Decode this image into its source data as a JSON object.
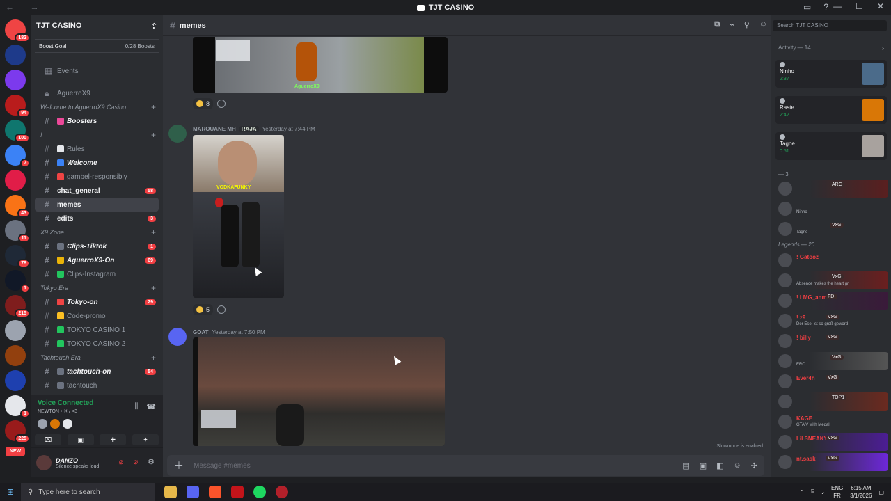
{
  "window": {
    "title": "TJT CASINO",
    "nav_arrows": "← →",
    "controls": [
      "—",
      "☐",
      "✕"
    ]
  },
  "server_rail": {
    "badges": [
      "182",
      "94",
      "100",
      "7",
      "43",
      "11",
      "78",
      "1",
      "215",
      "1",
      "225"
    ],
    "new_label": "NEW",
    "colors": [
      "#ef4444",
      "#1e3a8a",
      "#7c3aed",
      "#b91c1c",
      "#0f766e",
      "#3b82f6",
      "#e11d48",
      "#f97316",
      "#6b7280",
      "#1f2937",
      "#111827",
      "#7f1d1d",
      "#9ca3af",
      "#92400e",
      "#1e40af",
      "#e5e7eb",
      "#991b1b",
      "#b45309"
    ]
  },
  "sidebar": {
    "guild_name": "TJT CASINO",
    "boost_goal": "Boost Goal",
    "boost_count": "0/28 Boosts",
    "events": "Events",
    "channels": [
      {
        "type": "ch",
        "label": "AguerroX9",
        "icon": "lock",
        "bold": false
      },
      {
        "type": "cat",
        "label": "Welcome to AguerroX9 Casino"
      },
      {
        "type": "ch",
        "label": "Boosters",
        "bold": true,
        "emoji": "#ec4899"
      },
      {
        "type": "cat",
        "label": "!"
      },
      {
        "type": "ch",
        "label": "Rules",
        "bold": false,
        "emoji": "#e5e7eb"
      },
      {
        "type": "ch",
        "label": "Welcome",
        "bold": true,
        "emoji": "#3b82f6"
      },
      {
        "type": "ch",
        "label": "gambel-responsibly",
        "bold": false,
        "emoji": "#ef4444"
      },
      {
        "type": "ch",
        "label": "chat_general",
        "bold": true,
        "badge": "58"
      },
      {
        "type": "ch",
        "label": "memes",
        "bold": true,
        "active": true
      },
      {
        "type": "ch",
        "label": "edits",
        "bold": true,
        "badge": "3"
      },
      {
        "type": "cat",
        "label": "X9 Zone"
      },
      {
        "type": "ch",
        "label": "Clips-Tiktok",
        "bold": true,
        "badge": "1",
        "emoji": "#6b7280"
      },
      {
        "type": "ch",
        "label": "AguerroX9-On",
        "bold": true,
        "badge": "69",
        "emoji": "#eab308"
      },
      {
        "type": "ch",
        "label": "Clips-Instagram",
        "bold": false,
        "emoji": "#22c55e"
      },
      {
        "type": "cat",
        "label": "Tokyo Era"
      },
      {
        "type": "ch",
        "label": "Tokyo-on",
        "bold": true,
        "badge": "29",
        "emoji": "#ef4444"
      },
      {
        "type": "ch",
        "label": "Code-promo",
        "bold": false,
        "emoji": "#fbbf24"
      },
      {
        "type": "ch",
        "label": "TOKYO CASINO 1",
        "bold": false,
        "emoji": "#22c55e"
      },
      {
        "type": "ch",
        "label": "TOKYO CASINO 2",
        "bold": false,
        "emoji": "#22c55e"
      },
      {
        "type": "cat",
        "label": "Tachtouch Era"
      },
      {
        "type": "ch",
        "label": "tachtouch-on",
        "bold": true,
        "badge": "54",
        "emoji": "#6b7280"
      },
      {
        "type": "ch",
        "label": "tachtouch",
        "bold": false,
        "emoji": "#6b7280"
      }
    ],
    "voice": {
      "status": "Voice Connected",
      "sub": "NEWTON • ✕ / <3"
    },
    "user": {
      "name": "DANZO",
      "status": "Silence speaks loud"
    }
  },
  "main": {
    "channel": "memes",
    "messages": [
      {
        "author": "MAROUANE MH",
        "tag": "RAJA",
        "time": "Yesterday at 7:44 PM",
        "clip_label": "VODKAFUNKY",
        "reaction_count": "5"
      },
      {
        "author": "GOAT",
        "time": "Yesterday at 7:50 PM"
      }
    ],
    "top_reaction_count": "8",
    "top_clip_label": "AguerroX9",
    "slowmode": "Slowmode is enabled.",
    "composer_placeholder": "Message #memes"
  },
  "members": {
    "search_placeholder": "Search TJT CASINO",
    "activity_header": "Activity — 14",
    "activities": [
      {
        "name": "Ninho",
        "time": "2:37",
        "color": "#4b6b8a"
      },
      {
        "name": "Raste",
        "time": "2:42",
        "color": "#d97706"
      },
      {
        "name": "Tagne",
        "time": "0:51",
        "color": "#a8a29e"
      }
    ],
    "group1": "— 3",
    "group2": "Legends — 20",
    "list": [
      {
        "name": "",
        "status": "",
        "tag": "ARC",
        "color": "#f23f43",
        "bg": "#5a1f1f"
      },
      {
        "name": "",
        "status": "Ninho",
        "color": "#b5bac1",
        "bg": ""
      },
      {
        "name": "",
        "status": "Tagne",
        "tag": "VxG",
        "color": "#b5bac1",
        "bg": ""
      },
      {
        "name": "! Gatooz",
        "status": "",
        "color": "#f23f43",
        "bg": ""
      },
      {
        "name": "",
        "status": "Absence makes the heart gr",
        "tag": "VxG",
        "color": "#f23f43",
        "bg": "#6b1f1f"
      },
      {
        "name": "! LMG_anm...",
        "status": "",
        "tag": "FDI",
        "color": "#f23f43",
        "bg": "#3a1a3a"
      },
      {
        "name": "! z9",
        "status": "Der Esel ist so groß geword",
        "tag": "VxG",
        "color": "#f23f43",
        "bg": ""
      },
      {
        "name": "! billy",
        "status": "",
        "tag": "VxG",
        "color": "#f23f43",
        "bg": ""
      },
      {
        "name": "",
        "status": "ERO",
        "tag": "VxG",
        "color": "#f23f43",
        "bg": "#555"
      },
      {
        "name": "Ever4h",
        "status": "",
        "tag": "VxG",
        "color": "#f23f43",
        "bg": ""
      },
      {
        "name": "",
        "status": "",
        "tag": "TOP1",
        "color": "#f23f43",
        "bg": "#6b2a1f"
      },
      {
        "name": "KAGE",
        "status": "GTA V with Medal",
        "color": "#f23f43",
        "bg": ""
      },
      {
        "name": "Lil SNEAKY",
        "status": "",
        "tag": "VxG",
        "color": "#f23f43",
        "bg": "#4c1d95"
      },
      {
        "name": "nt.sask",
        "status": "",
        "tag": "VxG",
        "color": "#f23f43",
        "bg": "#6d28d9"
      }
    ]
  },
  "taskbar": {
    "search_placeholder": "Type here to search",
    "lang_top": "ENG",
    "lang_bottom": "FR",
    "time": "6:15 AM",
    "date": "3/1/2026"
  }
}
